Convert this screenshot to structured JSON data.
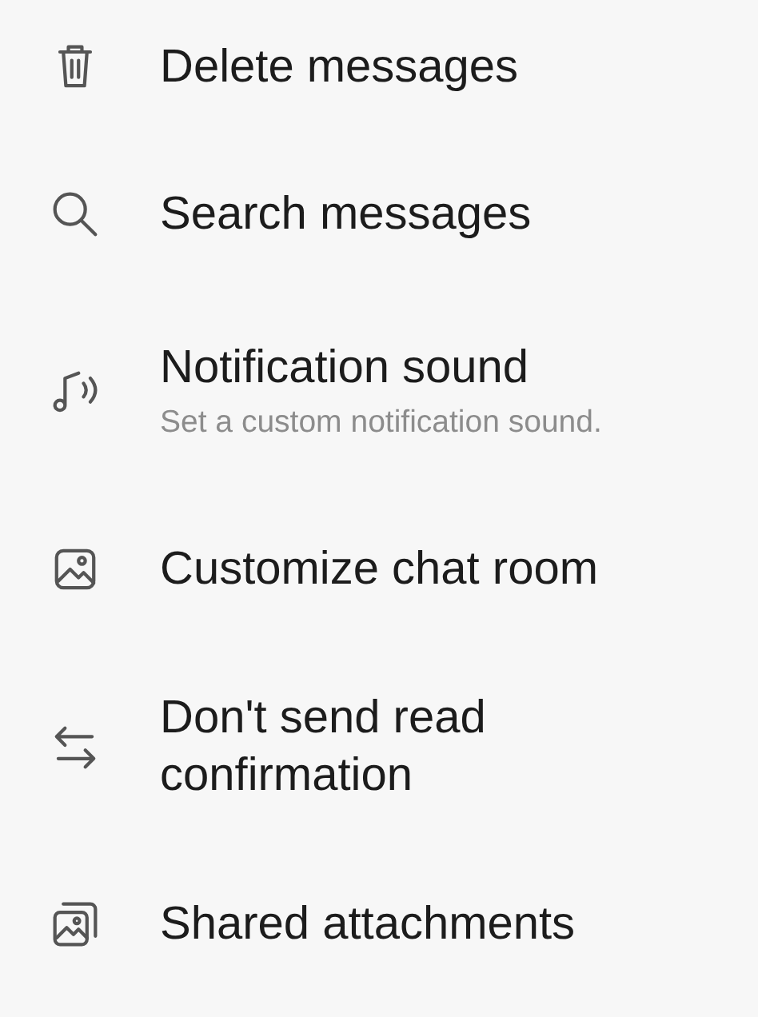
{
  "menu": {
    "items": [
      {
        "title": "Delete messages"
      },
      {
        "title": "Search messages"
      },
      {
        "title": "Notification sound",
        "subtitle": "Set a custom notification sound."
      },
      {
        "title": "Customize chat room"
      },
      {
        "title": "Don't send read confirmation"
      },
      {
        "title": "Shared attachments"
      }
    ]
  }
}
